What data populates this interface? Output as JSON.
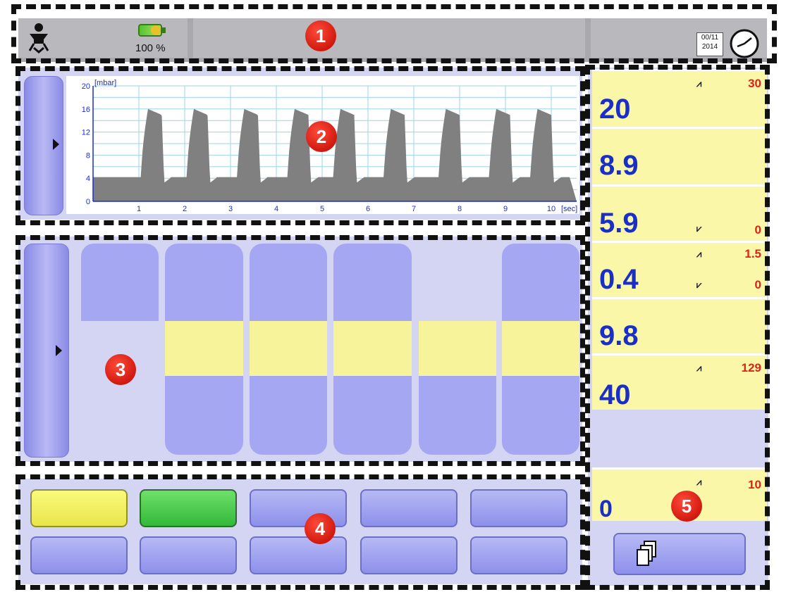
{
  "status_bar": {
    "battery_percent": "100 %",
    "date_line1": "00/11",
    "date_line2": "2014"
  },
  "waveform": {
    "unit_label": "[mbar]",
    "y_ticks": [
      "0",
      "4",
      "8",
      "12",
      "16",
      "20"
    ],
    "x_ticks": [
      "1",
      "2",
      "3",
      "4",
      "5",
      "6",
      "7",
      "8",
      "9",
      "10"
    ],
    "x_unit": "[sec]"
  },
  "parameters": [
    {
      "value": "20",
      "alarm_high": "30"
    },
    {
      "value": "8.9"
    },
    {
      "value": "5.9",
      "alarm_low": "0"
    },
    {
      "value": "0.4",
      "alarm_high": "1.5",
      "alarm_low": "0"
    },
    {
      "value": "9.8"
    },
    {
      "value": "40",
      "alarm_high": "129"
    },
    {
      "value": "0",
      "alarm_high": "10"
    }
  ],
  "markers": [
    "1",
    "2",
    "3",
    "4",
    "5"
  ],
  "icons": {
    "patient": "infant-icon",
    "battery": "battery-icon",
    "clock": "calendar-clock-icon",
    "alarm_high": "upper-alarm-limit-icon",
    "alarm_low": "lower-alarm-limit-icon",
    "pages": "pages-icon"
  },
  "colors": {
    "value_blue": "#1a2fc7",
    "alarm_red": "#e0201a",
    "param_bg": "#fbf7a8",
    "wave_fill": "#808080"
  }
}
